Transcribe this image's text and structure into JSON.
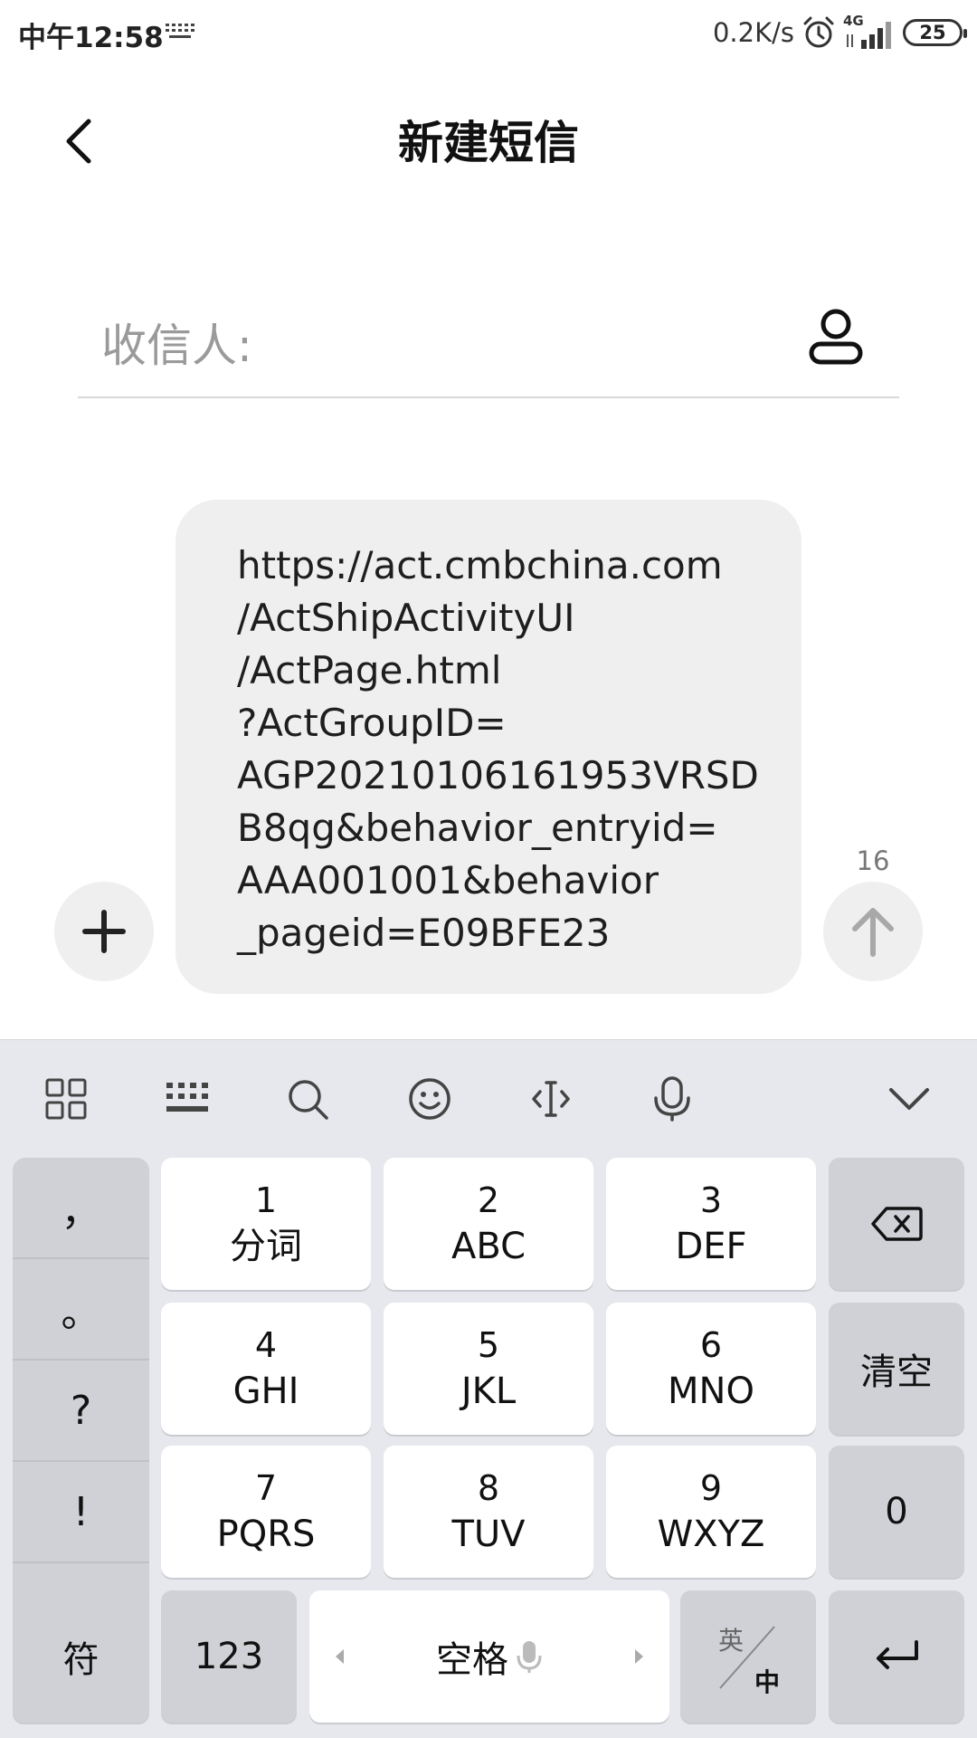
{
  "status_bar": {
    "time": "中午12:58",
    "net_speed": "0.2K/s",
    "network_type": "4G",
    "battery": "25",
    "icons": [
      "keyboard-indicator-icon",
      "alarm-icon",
      "signal-icon",
      "battery-icon"
    ]
  },
  "header": {
    "title": "新建短信",
    "back_icon": "chevron-left-icon"
  },
  "recipient": {
    "label": "收信人:",
    "contact_icon": "person-icon"
  },
  "compose": {
    "message_text": "https://act.cmbchina.com\n/ActShipActivityUI\n/ActPage.html\n?ActGroupID=\nAGP20210106161953VRSD\nB8qg&behavior_entryid=\nAAA001001&behavior\n_pageid=E09BFE23",
    "char_count": "16",
    "attach_icon": "plus-icon",
    "send_icon": "arrow-up-icon"
  },
  "keyboard": {
    "toolbar": [
      "grid-icon",
      "keyboard-icon",
      "search-icon",
      "emoji-icon",
      "cursor-icon",
      "microphone-icon",
      "chevron-down-icon"
    ],
    "punctuation": [
      "，",
      "。",
      "?",
      "!"
    ],
    "keys": [
      {
        "num": "1",
        "letters": "分词"
      },
      {
        "num": "2",
        "letters": "ABC"
      },
      {
        "num": "3",
        "letters": "DEF"
      },
      {
        "num": "4",
        "letters": "GHI"
      },
      {
        "num": "5",
        "letters": "JKL"
      },
      {
        "num": "6",
        "letters": "MNO"
      },
      {
        "num": "7",
        "letters": "PQRS"
      },
      {
        "num": "8",
        "letters": "TUV"
      },
      {
        "num": "9",
        "letters": "WXYZ"
      }
    ],
    "clear_label": "清空",
    "zero_label": "0",
    "symbols_label": "符",
    "numbers_label": "123",
    "space_label": "空格",
    "lang_en": "英",
    "lang_zh": "中",
    "colors": {
      "background": "#e6e8ed",
      "key": "#ffffff",
      "function_key": "#cfd1d7"
    }
  }
}
